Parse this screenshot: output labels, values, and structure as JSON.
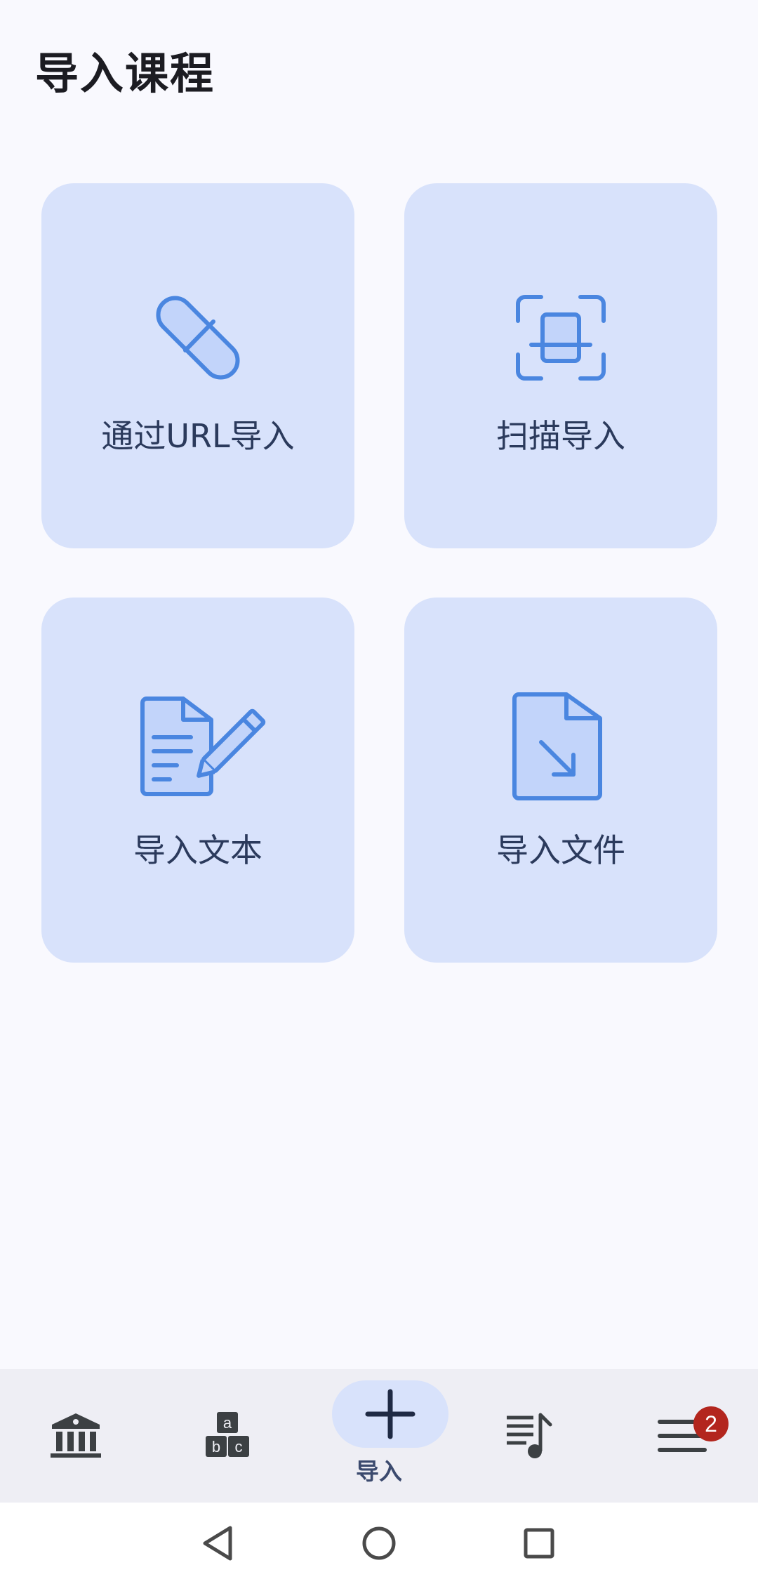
{
  "header": {
    "title": "导入课程"
  },
  "cards": [
    {
      "id": "url",
      "label": "通过URL导入",
      "icon": "paperclip-icon"
    },
    {
      "id": "scan",
      "label": "扫描导入",
      "icon": "scan-icon"
    },
    {
      "id": "text",
      "label": "导入文本",
      "icon": "edit-document-icon"
    },
    {
      "id": "file",
      "label": "导入文件",
      "icon": "file-import-icon"
    }
  ],
  "bottom_nav": {
    "items": [
      {
        "id": "library",
        "icon": "library-icon",
        "label": ""
      },
      {
        "id": "vocab",
        "icon": "abc-blocks-icon",
        "label": ""
      },
      {
        "id": "import",
        "icon": "plus-icon",
        "label": "导入",
        "active": true
      },
      {
        "id": "playlist",
        "icon": "playlist-music-icon",
        "label": ""
      },
      {
        "id": "menu",
        "icon": "menu-icon",
        "label": "",
        "badge": "2"
      }
    ]
  },
  "system_nav": {
    "buttons": [
      "back-icon",
      "home-icon",
      "recents-icon"
    ]
  },
  "colors": {
    "background": "#f9f9fe",
    "card": "#d8e2fb",
    "icon_stroke": "#4a86e0",
    "icon_fill": "#c2d4fa",
    "label": "#2b3a5c",
    "badge": "#b3261e",
    "nav_bar": "#eeeef4"
  }
}
